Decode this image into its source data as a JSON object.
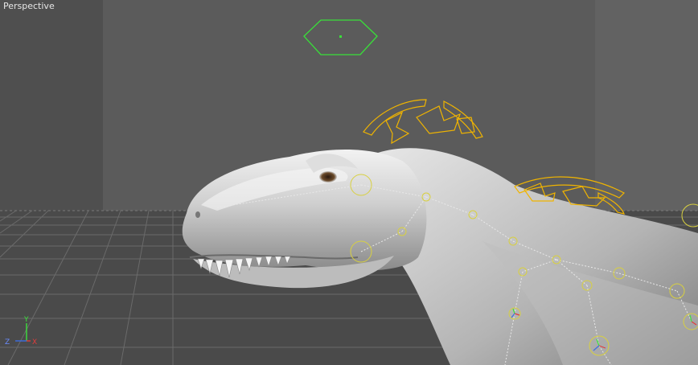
{
  "viewport": {
    "label": "Perspective",
    "axis_gizmo": {
      "y": "Y",
      "z": "Z",
      "x": "X"
    }
  },
  "colors": {
    "background": "#555555",
    "controller_green": "#39e039",
    "controller_yellow": "#f0b400",
    "joint_yellow": "#d8d040",
    "mesh": "#c8c8c8",
    "axis_x": "#e03c3c",
    "axis_y": "#3ce03c",
    "axis_z": "#3c6ce0"
  },
  "icons": [
    "hexagon-controller",
    "arrow-controller",
    "joint-marker",
    "axis-gizmo"
  ]
}
